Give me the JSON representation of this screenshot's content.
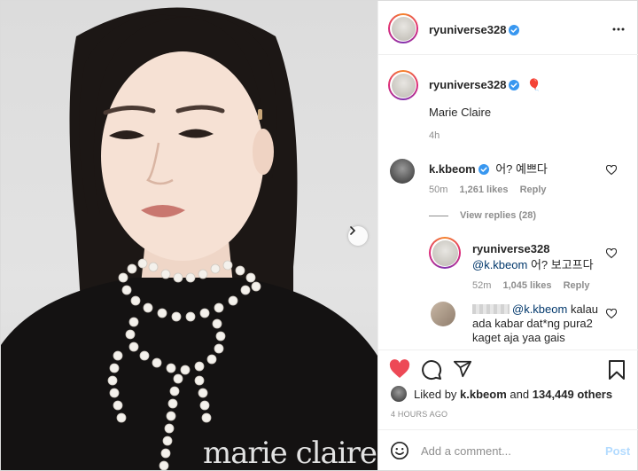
{
  "post": {
    "author": "ryuniverse328",
    "caption_author": "ryuniverse328",
    "caption_emoji": "🎈",
    "caption": "Marie Claire",
    "caption_time": "4h",
    "brand_watermark": "marie claire"
  },
  "comments": [
    {
      "user": "k.kbeom",
      "text": "어? 예쁘다",
      "time": "50m",
      "likes": "1,261 likes",
      "reply": "Reply",
      "view_replies": "View replies (28)"
    },
    {
      "user": "ryuniverse328",
      "mention": "@k.kbeom",
      "text": "어? 보고프다",
      "time": "52m",
      "likes": "1,045 likes",
      "reply": "Reply"
    },
    {
      "mention": "@k.kbeom",
      "line1": "kalau",
      "line2": "ada kabar dat*ng pura2",
      "line3": "kaget aja yaa gais"
    }
  ],
  "likes": {
    "prefix": "Liked by",
    "user": "k.kbeom",
    "middle": "and",
    "others": "134,449 others"
  },
  "timestamp": "4 HOURS AGO",
  "comment_box": {
    "placeholder": "Add a comment...",
    "post_label": "Post"
  },
  "colors": {
    "verified": "#3897f0",
    "like_red": "#ed4956",
    "link": "#00376b",
    "muted": "#8e8e8e"
  }
}
